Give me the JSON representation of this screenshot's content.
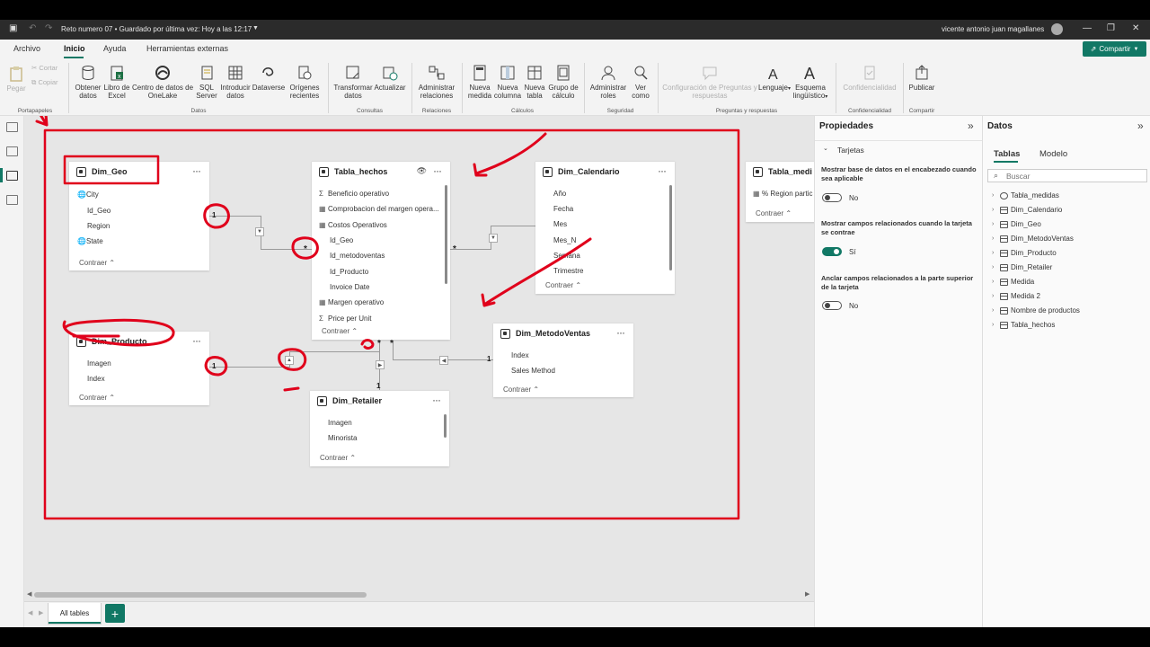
{
  "titlebar": {
    "title": "Reto numero 07 • Guardado por última vez: Hoy a las 12:17",
    "user": "vicente antonio juan magallanes"
  },
  "menu": {
    "tabs": [
      "Archivo",
      "Inicio",
      "Ayuda",
      "Herramientas externas"
    ],
    "active_tab": "Inicio",
    "share_label": "Compartir"
  },
  "ribbon": {
    "clipboard": {
      "paste": "Pegar",
      "cut": "Cortar",
      "copy": "Copiar",
      "label": "Portapapeles"
    },
    "datos": {
      "label": "Datos",
      "items": [
        "Obtener datos",
        "Libro de Excel",
        "Centro de datos de OneLake",
        "SQL Server",
        "Introducir datos",
        "Dataverse",
        "Orígenes recientes"
      ]
    },
    "consultas": {
      "label": "Consultas",
      "items": [
        "Transformar datos",
        "Actualizar"
      ]
    },
    "relaciones": {
      "label": "Relaciones",
      "items": [
        "Administrar relaciones"
      ]
    },
    "calculos": {
      "label": "Cálculos",
      "items": [
        "Nueva medida",
        "Nueva columna",
        "Nueva tabla",
        "Grupo de cálculo"
      ]
    },
    "seguridad": {
      "label": "Seguridad",
      "items": [
        "Administrar roles",
        "Ver como"
      ]
    },
    "preguntas": {
      "label": "Preguntas y respuestas",
      "items": [
        "Configuración de Preguntas y respuestas",
        "Lenguaje",
        "Esquema lingüístico"
      ]
    },
    "confidencialidad": {
      "label": "Confidencialidad",
      "items": [
        "Confidencialidad"
      ]
    },
    "compartir": {
      "label": "Compartir",
      "items": [
        "Publicar"
      ]
    }
  },
  "model": {
    "collapse_label": "Contraer",
    "tables": {
      "dim_geo": {
        "title": "Dim_Geo",
        "fields": [
          "City",
          "Id_Geo",
          "Region",
          "State"
        ]
      },
      "tabla_hechos": {
        "title": "Tabla_hechos",
        "fields": [
          "Beneficio operativo",
          "Comprobacion del margen opera...",
          "Costos Operativos",
          "Id_Geo",
          "Id_metodoventas",
          "Id_Producto",
          "Invoice Date",
          "Margen operativo",
          "Price per Unit"
        ]
      },
      "dim_calendario": {
        "title": "Dim_Calendario",
        "fields": [
          "Año",
          "Fecha",
          "Mes",
          "Mes_N",
          "Semana",
          "Trimestre"
        ]
      },
      "tabla_medidas": {
        "title": "Tabla_medi",
        "fields": [
          "% Region partic"
        ]
      },
      "dim_producto": {
        "title": "Dim_Producto",
        "fields": [
          "Imagen",
          "Index"
        ]
      },
      "dim_metodoventas": {
        "title": "Dim_MetodoVentas",
        "fields": [
          "Index",
          "Sales Method"
        ]
      },
      "dim_retailer": {
        "title": "Dim_Retailer",
        "fields": [
          "Imagen",
          "Minorista"
        ]
      }
    },
    "cardinality": {
      "one": "1",
      "many": "*"
    },
    "layout_tab": "All tables"
  },
  "properties": {
    "title": "Propiedades",
    "section": "Tarjetas",
    "options": [
      {
        "label": "Mostrar base de datos en el encabezado cuando sea aplicable",
        "state": "No",
        "on": false
      },
      {
        "label": "Mostrar campos relacionados cuando la tarjeta se contrae",
        "state": "Sí",
        "on": true
      },
      {
        "label": "Anclar campos relacionados a la parte superior de la tarjeta",
        "state": "No",
        "on": false
      }
    ]
  },
  "datapane": {
    "title": "Datos",
    "tabs": [
      "Tablas",
      "Modelo"
    ],
    "active_tab": "Tablas",
    "search_placeholder": "Buscar",
    "items": [
      "Tabla_medidas",
      "Dim_Calendario",
      "Dim_Geo",
      "Dim_MetodoVentas",
      "Dim_Producto",
      "Dim_Retailer",
      "Medida",
      "Medida 2",
      "Nombre de productos",
      "Tabla_hechos"
    ]
  },
  "colors": {
    "accent": "#117865",
    "annotation": "#e0001b"
  }
}
